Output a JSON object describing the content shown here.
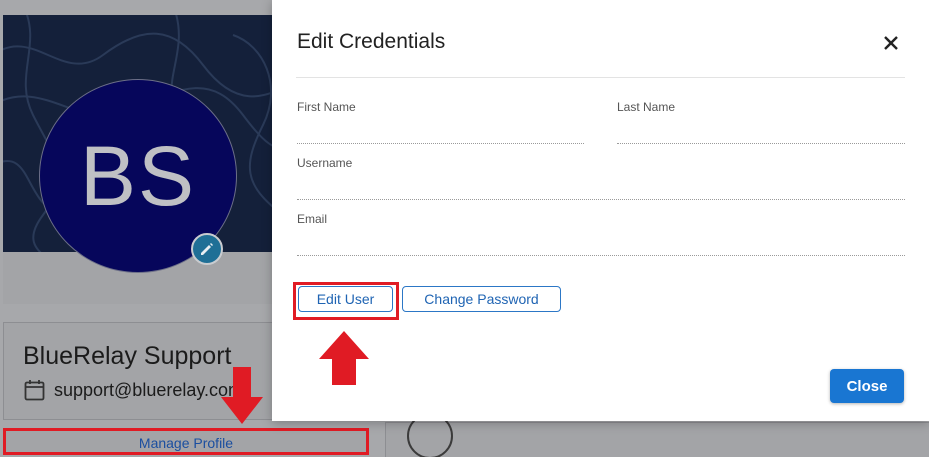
{
  "background": {
    "avatar_initials": "BS",
    "profile_name": "BlueRelay Support",
    "profile_email": "support@bluerelay.com",
    "manage_profile_label": "Manage Profile"
  },
  "modal": {
    "title": "Edit Credentials",
    "fields": {
      "first_name": {
        "label": "First Name",
        "value": ""
      },
      "last_name": {
        "label": "Last Name",
        "value": ""
      },
      "username": {
        "label": "Username",
        "value": ""
      },
      "email": {
        "label": "Email",
        "value": ""
      }
    },
    "edit_user_label": "Edit User",
    "change_password_label": "Change Password",
    "close_label": "Close"
  },
  "colors": {
    "accent": "#1976d2",
    "annotation_red": "#e01b24",
    "avatar_bg": "#06065b"
  },
  "icons": [
    "pencil-icon",
    "calendar-icon",
    "close-icon",
    "arrow-down-icon",
    "arrow-up-icon"
  ]
}
